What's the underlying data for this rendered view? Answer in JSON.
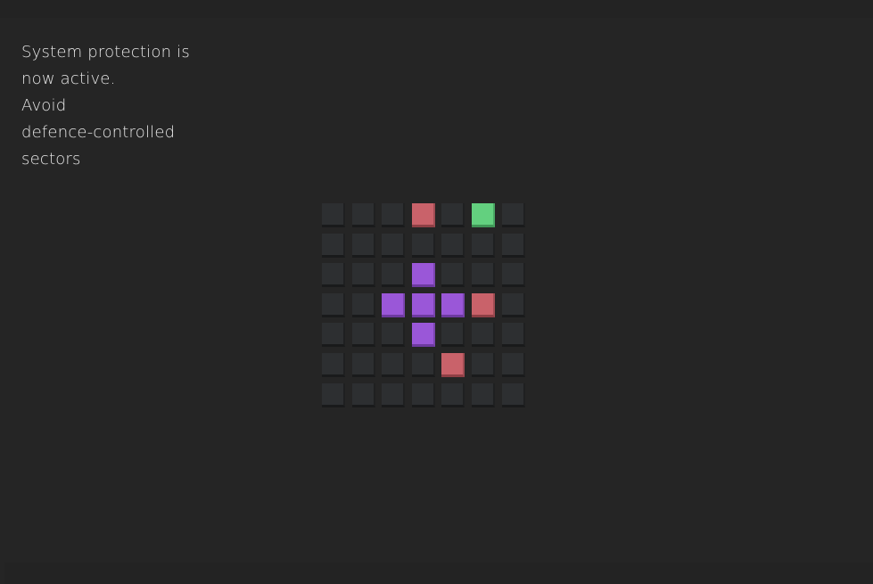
{
  "message": {
    "lines": [
      "System protection is",
      "now active.",
      "Avoid",
      "defence-controlled",
      "sectors"
    ]
  },
  "board": {
    "rows": 7,
    "cols": 7,
    "cell_colors": {
      "empty": "#2d2f31",
      "purple": "#9a57d8",
      "red": "#c9626a",
      "green": "#63d07f"
    },
    "grid": [
      [
        "empty",
        "empty",
        "empty",
        "red",
        "empty",
        "green",
        "empty"
      ],
      [
        "empty",
        "empty",
        "empty",
        "empty",
        "empty",
        "empty",
        "empty"
      ],
      [
        "empty",
        "empty",
        "empty",
        "purple",
        "empty",
        "empty",
        "empty"
      ],
      [
        "empty",
        "empty",
        "purple",
        "purple",
        "purple",
        "red",
        "empty"
      ],
      [
        "empty",
        "empty",
        "empty",
        "purple",
        "empty",
        "empty",
        "empty"
      ],
      [
        "empty",
        "empty",
        "empty",
        "empty",
        "red",
        "empty",
        "empty"
      ],
      [
        "empty",
        "empty",
        "empty",
        "empty",
        "empty",
        "empty",
        "empty"
      ]
    ]
  }
}
